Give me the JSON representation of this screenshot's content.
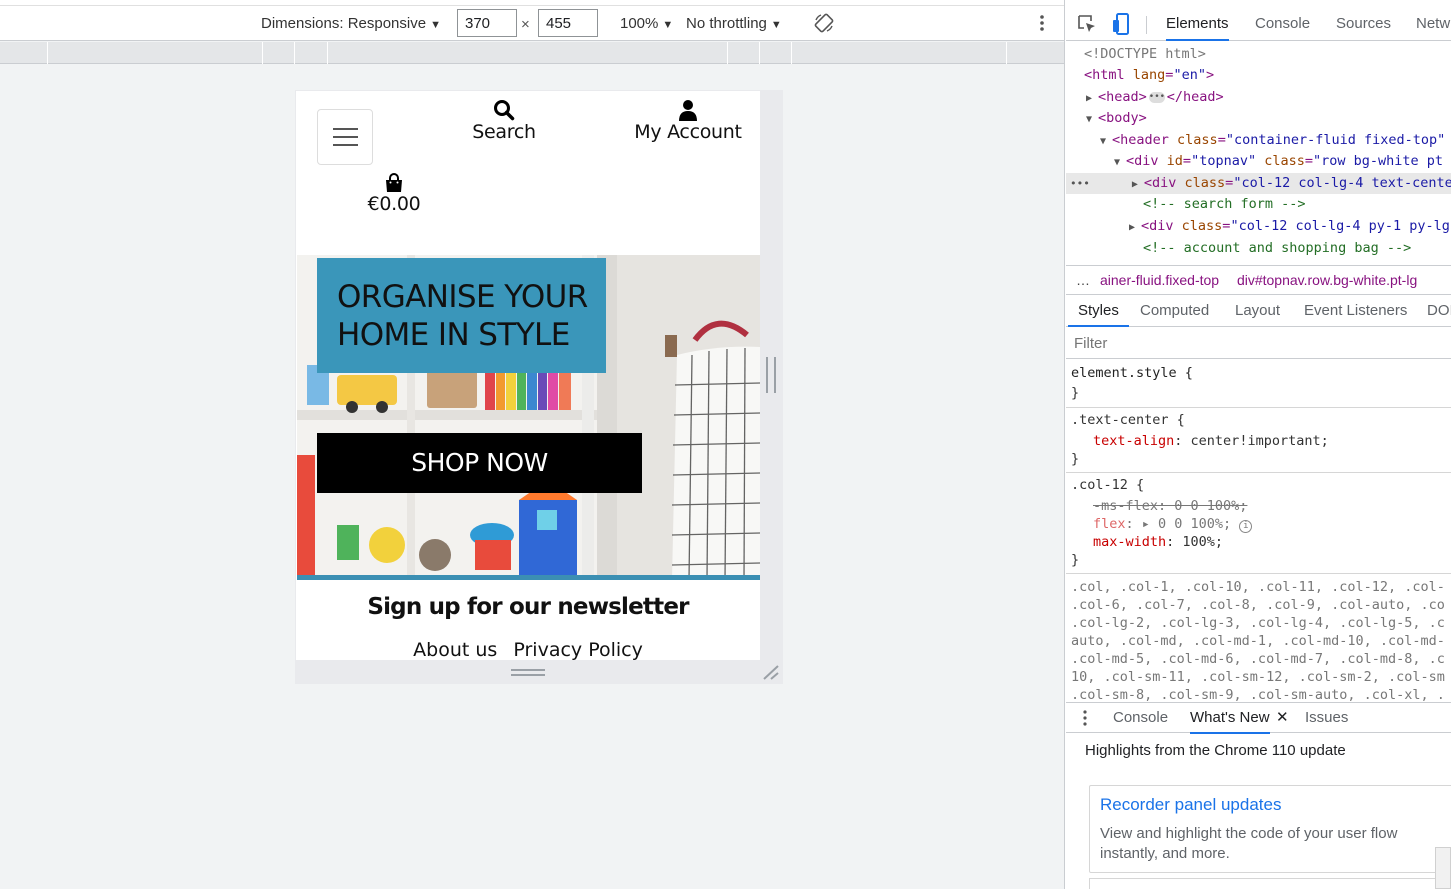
{
  "device_toolbar": {
    "dimensions_label": "Dimensions: Responsive",
    "width_value": "370",
    "height_value": "455",
    "times": "×",
    "zoom": "100%",
    "throttling": "No throttling"
  },
  "site": {
    "nav": {
      "search_label": "Search",
      "account_label": "My Account",
      "bag_total": "€0.00"
    },
    "hero": {
      "title_line1": "ORGANISE YOUR",
      "title_line2": "HOME IN STYLE",
      "cta": "SHOP NOW"
    },
    "newsletter": "Sign up for our newsletter",
    "footer_links": [
      "About us",
      "Privacy Policy"
    ]
  },
  "devtools": {
    "tabs": [
      "Elements",
      "Console",
      "Sources",
      "Netw"
    ],
    "active_tab": "Elements",
    "dom": {
      "doctype": "<!DOCTYPE html>",
      "html_open": "<html",
      "html_lang_attr": "lang",
      "html_lang_val": "\"en\"",
      "head": "<head>",
      "head_close": "</head>",
      "body": "<body>",
      "header_tag": "<header",
      "header_attr": "class",
      "header_val": "\"container-fluid fixed-top\"",
      "div_tag": "<div",
      "topnav_id_attr": "id",
      "topnav_id_val": "\"topnav\"",
      "topnav_class_attr": "class",
      "topnav_class_val": "\"row bg-white pt",
      "sel_div_class_attr": "class",
      "sel_div_class_val": "\"col-12 col-lg-4 text-cente",
      "comment_search": "<!-- search form -->",
      "div2_class_val": "\"col-12 col-lg-4 py-1 py-lg",
      "comment_account": "<!-- account and shopping bag -->"
    },
    "breadcrumbs": [
      "ainer-fluid.fixed-top",
      "div#topnav.row.bg-white.pt-lg"
    ],
    "breadcrumbs_more": "…",
    "style_tabs": [
      "Styles",
      "Computed",
      "Layout",
      "Event Listeners",
      "DOI"
    ],
    "filter_placeholder": "Filter",
    "rules": {
      "element_style": "element.style {",
      "close": "}",
      "text_center_sel": ".text-center {",
      "text_align_prop": "text-align",
      "text_align_val": "center!important;",
      "col12_sel": ".col-12 {",
      "ms_flex": "-ms-flex: 0 0 100%;",
      "flex_prop": "flex",
      "flex_val": "▸ 0 0 100%;",
      "max_width_prop": "max-width",
      "max_width_val": "100%;",
      "col_list": [
        ".col, .col-1, .col-10, .col-11, .col-12, .col-",
        ".col-6, .col-7, .col-8, .col-9, .col-auto, .co",
        ".col-lg-2, .col-lg-3, .col-lg-4, .col-lg-5, .c",
        "auto, .col-md, .col-md-1, .col-md-10, .col-md-",
        ".col-md-5, .col-md-6, .col-md-7, .col-md-8, .c",
        "10, .col-sm-11, .col-sm-12, .col-sm-2, .col-sm",
        ".col-sm-8, .col-sm-9, .col-sm-auto, .col-xl, ."
      ]
    },
    "drawer_tabs": [
      "Console",
      "What's New",
      "Issues"
    ],
    "drawer_close": "✕",
    "highlights": "Highlights from the Chrome 110 update",
    "card": {
      "title": "Recorder panel updates",
      "text": "View and highlight the code of your user flow instantly, and more."
    }
  }
}
